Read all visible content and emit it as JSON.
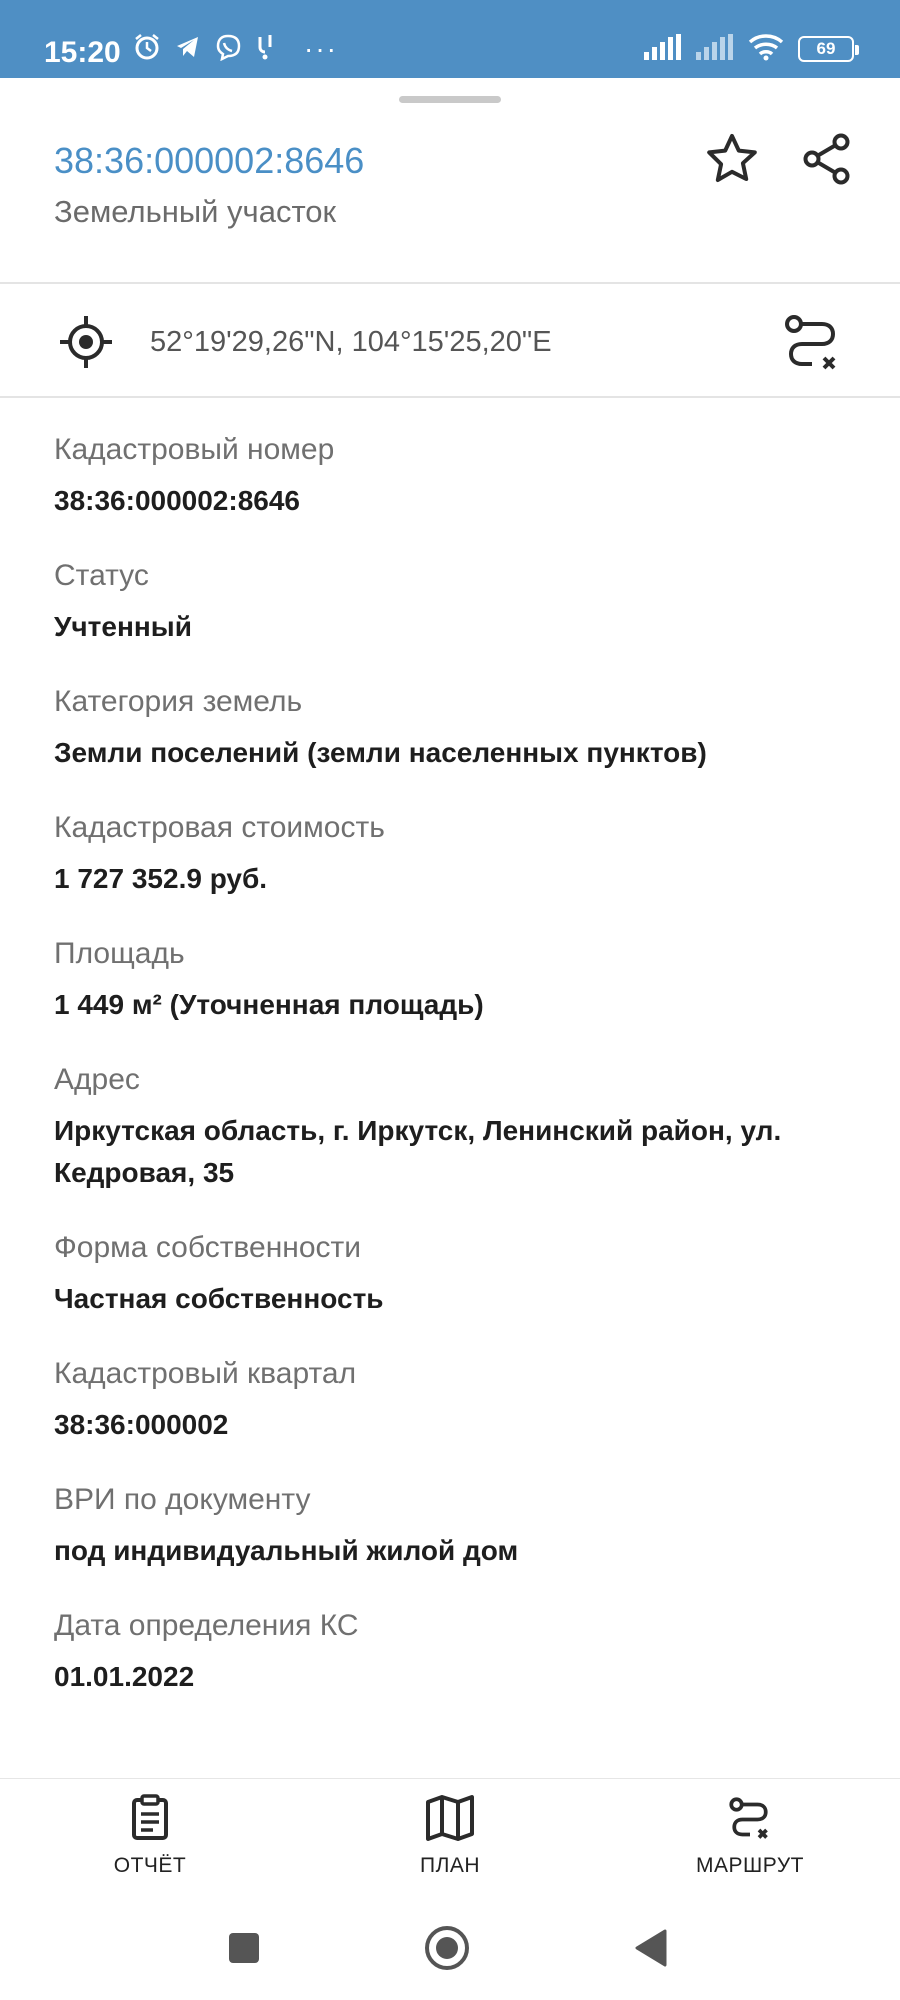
{
  "status_bar": {
    "time": "15:20",
    "battery": "69",
    "left_icons": [
      "alarm-icon",
      "telegram-icon",
      "viber-icon",
      "notification-icon"
    ],
    "right_icons": [
      "signal-icon",
      "signal-icon-2",
      "wifi-icon",
      "battery-icon"
    ],
    "more": "···"
  },
  "header": {
    "title": "38:36:000002:8646",
    "subtitle": "Земельный участок",
    "accent_color": "#4a8fc6"
  },
  "location": {
    "coordinates": "52°19'29,26\"N, 104°15'25,20\"E"
  },
  "fields": [
    {
      "label": "Кадастровый номер",
      "value": "38:36:000002:8646"
    },
    {
      "label": "Статус",
      "value": "Учтенный"
    },
    {
      "label": "Категория земель",
      "value": "Земли поселений (земли населенных пунктов)"
    },
    {
      "label": "Кадастровая стоимость",
      "value": "1 727 352.9 руб."
    },
    {
      "label": "Площадь",
      "value": "1 449 м² (Уточненная площадь)"
    },
    {
      "label": "Адрес",
      "value": "Иркутская область, г. Иркутск, Ленинский район, ул. Кедровая, 35"
    },
    {
      "label": "Форма собственности",
      "value": "Частная собственность"
    },
    {
      "label": "Кадастровый квартал",
      "value": "38:36:000002"
    },
    {
      "label": "ВРИ по документу",
      "value": "под индивидуальный жилой дом"
    },
    {
      "label": "Дата определения КС",
      "value": "01.01.2022"
    }
  ],
  "bottom_nav": {
    "report": "ОТЧЁТ",
    "plan": "ПЛАН",
    "route": "МАРШРУТ"
  }
}
